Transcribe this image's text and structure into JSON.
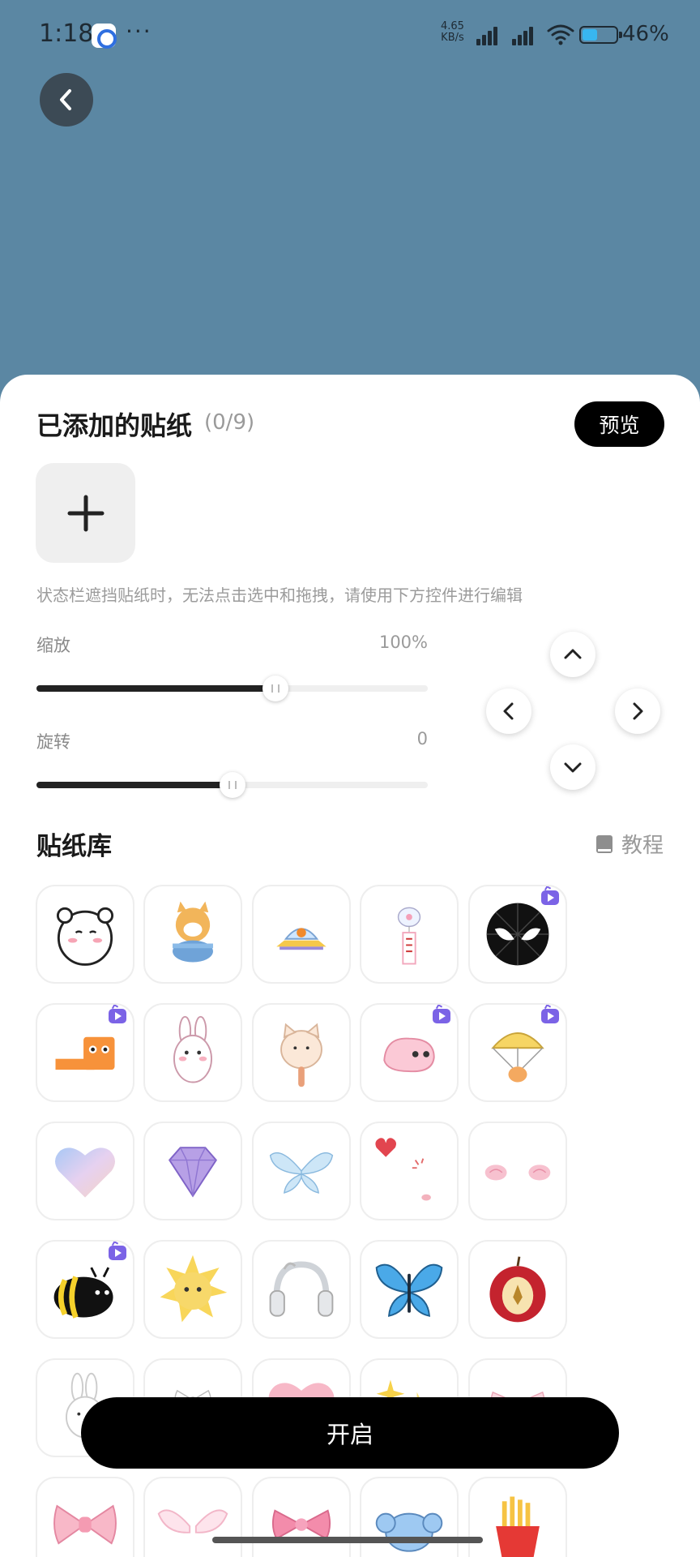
{
  "status_bar": {
    "time": "1:18",
    "dots": "···",
    "speed_value": "4.65",
    "speed_unit": "KB/s",
    "battery_level": 46,
    "battery_text": "46%",
    "battery_color": "#38b6f0"
  },
  "colors": {
    "backdrop": "#5b87a3",
    "accent": "#000000",
    "badge": "#7b63e6"
  },
  "added": {
    "title": "已添加的贴纸",
    "count": "(0/9)",
    "preview_label": "预览",
    "hint": "状态栏遮挡贴纸时，无法点击选中和拖拽，请使用下方控件进行编辑"
  },
  "controls": {
    "scale": {
      "label": "缩放",
      "value_text": "100%",
      "fraction": 0.61
    },
    "rotate": {
      "label": "旋转",
      "value_text": "0",
      "fraction": 0.5
    }
  },
  "library": {
    "title": "贴纸库",
    "tutorial_label": "教程",
    "stickers": [
      {
        "name": "sticker-white-bear",
        "premium": false
      },
      {
        "name": "sticker-shiba-noodles",
        "premium": false
      },
      {
        "name": "sticker-ufo",
        "premium": false
      },
      {
        "name": "sticker-wind-chime",
        "premium": false
      },
      {
        "name": "sticker-spider-mask",
        "premium": true
      },
      {
        "name": "sticker-orange-block",
        "premium": true
      },
      {
        "name": "sticker-bunny",
        "premium": false
      },
      {
        "name": "sticker-cat",
        "premium": false
      },
      {
        "name": "sticker-pink-blob",
        "premium": true
      },
      {
        "name": "sticker-parachute-hamster",
        "premium": true
      },
      {
        "name": "sticker-holo-heart",
        "premium": false
      },
      {
        "name": "sticker-diamond",
        "premium": false
      },
      {
        "name": "sticker-glass-butterfly",
        "premium": false
      },
      {
        "name": "sticker-hearts-sparkle",
        "premium": false
      },
      {
        "name": "sticker-blush-cheeks",
        "premium": false
      },
      {
        "name": "sticker-bee",
        "premium": true
      },
      {
        "name": "sticker-sun",
        "premium": false
      },
      {
        "name": "sticker-headphones",
        "premium": false
      },
      {
        "name": "sticker-blue-butterfly",
        "premium": false
      },
      {
        "name": "sticker-apple",
        "premium": false
      },
      {
        "name": "sticker-miffy",
        "premium": false
      },
      {
        "name": "sticker-small-bow",
        "premium": false
      },
      {
        "name": "sticker-pink-heart",
        "premium": false
      },
      {
        "name": "sticker-sparkles",
        "premium": false
      },
      {
        "name": "sticker-pink-ribbon",
        "premium": false
      },
      {
        "name": "sticker-pink-bow",
        "premium": false
      },
      {
        "name": "sticker-wings",
        "premium": false
      },
      {
        "name": "sticker-pink-bow-2",
        "premium": false
      },
      {
        "name": "sticker-blue-elephant",
        "premium": false
      },
      {
        "name": "sticker-fries",
        "premium": false
      }
    ]
  },
  "open_label": "开启"
}
